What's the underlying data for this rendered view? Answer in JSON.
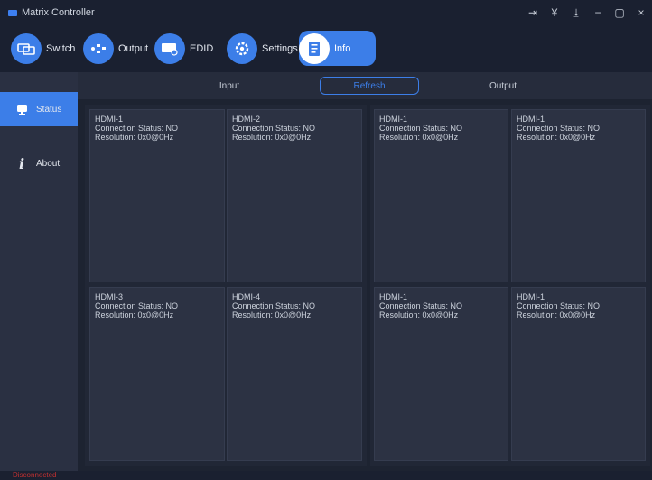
{
  "window": {
    "title": "Matrix Controller",
    "controls": [
      "⇥",
      "¥",
      "⤓",
      "−",
      "▢",
      "×"
    ]
  },
  "toolbar": {
    "items": [
      {
        "label": "Switch",
        "icon": "switch-icon"
      },
      {
        "label": "Output",
        "icon": "output-icon"
      },
      {
        "label": "EDID",
        "icon": "edid-icon"
      },
      {
        "label": "Settings",
        "icon": "settings-icon"
      },
      {
        "label": "Info",
        "icon": "info-icon",
        "active": true
      }
    ]
  },
  "sidebar": {
    "items": [
      {
        "label": "Status",
        "icon": "status-icon",
        "active": true
      },
      {
        "label": "About",
        "icon": "about-icon"
      }
    ]
  },
  "tabs": {
    "input": "Input",
    "refresh": "Refresh",
    "output": "Output"
  },
  "input_cards": [
    {
      "name": "HDMI-1",
      "status": "Connection Status: NO",
      "resolution": "Resolution: 0x0@0Hz"
    },
    {
      "name": "HDMI-2",
      "status": "Connection Status: NO",
      "resolution": "Resolution: 0x0@0Hz"
    },
    {
      "name": "HDMI-3",
      "status": "Connection Status: NO",
      "resolution": "Resolution: 0x0@0Hz"
    },
    {
      "name": "HDMI-4",
      "status": "Connection Status: NO",
      "resolution": "Resolution: 0x0@0Hz"
    }
  ],
  "output_cards": [
    {
      "name": "HDMI-1",
      "status": "Connection Status: NO",
      "resolution": "Resolution: 0x0@0Hz"
    },
    {
      "name": "HDMI-1",
      "status": "Connection Status: NO",
      "resolution": "Resolution: 0x0@0Hz"
    },
    {
      "name": "HDMI-1",
      "status": "Connection Status: NO",
      "resolution": "Resolution: 0x0@0Hz"
    },
    {
      "name": "HDMI-1",
      "status": "Connection Status: NO",
      "resolution": "Resolution: 0x0@0Hz"
    }
  ],
  "status_bar": {
    "text": "Disconnected"
  },
  "colors": {
    "accent": "#3c7ee8",
    "background": "#1d2331",
    "card": "#2c3243",
    "error": "#c03030"
  }
}
